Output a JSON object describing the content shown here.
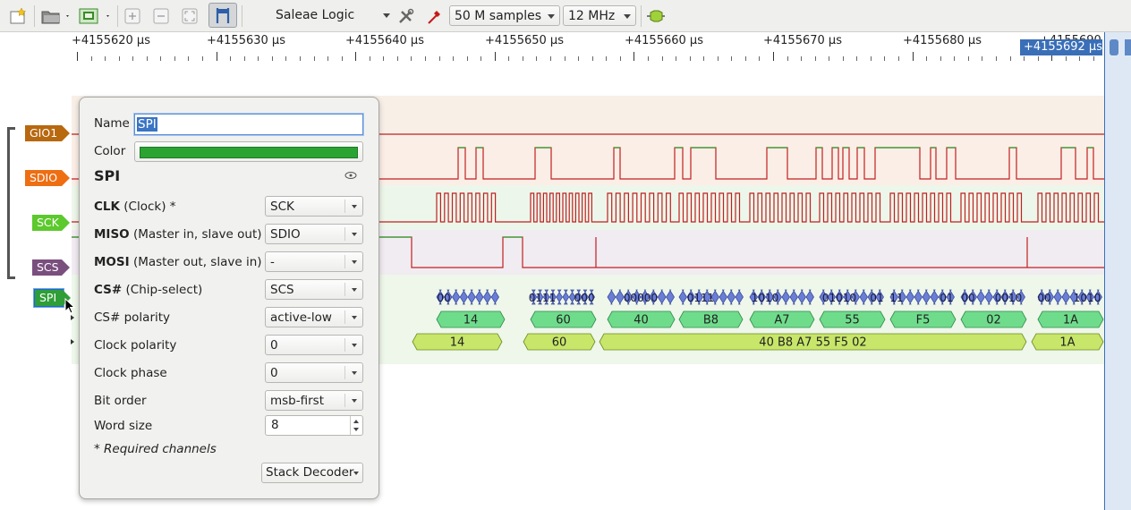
{
  "toolbar": {
    "device": "Saleae Logic",
    "samples": "50 M samples",
    "rate": "12 MHz"
  },
  "ruler": {
    "ticks": [
      "+4155620 µs",
      "+4155630 µs",
      "+4155640 µs",
      "+4155650 µs",
      "+4155660 µs",
      "+4155670 µs",
      "+4155680 µs"
    ],
    "partial_tick": "+4155690",
    "cursor": "+4155692 µs"
  },
  "channels": [
    {
      "name": "GIO1",
      "color": "#b8680f"
    },
    {
      "name": "SDIO",
      "color": "#ee6e12"
    },
    {
      "name": "SCK",
      "color": "#5cc92c"
    },
    {
      "name": "SCS",
      "color": "#7a4f7e"
    }
  ],
  "analyzer": {
    "name": "SPI",
    "color": "#2f9e38"
  },
  "decoded": {
    "bits": [
      "00",
      "0111",
      "000",
      "00000",
      "0111",
      "1010",
      "01010",
      "01",
      "11",
      "01",
      "00",
      "0010",
      "00",
      "1010"
    ],
    "bytes": [
      "14",
      "60",
      "40",
      "B8",
      "A7",
      "55",
      "F5",
      "02",
      "1A"
    ],
    "packets": [
      "14",
      "60",
      "40 B8 A7 55 F5 02",
      "1A"
    ]
  },
  "popup": {
    "name_label": "Name",
    "name_value": "SPI",
    "color_label": "Color",
    "color_value": "#2aa332",
    "title": "SPI",
    "rows": [
      {
        "bold": "CLK",
        "rest": " (Clock) *",
        "value": "SCK"
      },
      {
        "bold": "MISO",
        "rest": " (Master in, slave out)",
        "value": "SDIO"
      },
      {
        "bold": "MOSI",
        "rest": " (Master out, slave in)",
        "value": "-"
      },
      {
        "bold": "CS#",
        "rest": " (Chip-select)",
        "value": "SCS"
      },
      {
        "bold": "",
        "rest": "CS# polarity",
        "value": "active-low"
      },
      {
        "bold": "",
        "rest": "Clock polarity",
        "value": "0"
      },
      {
        "bold": "",
        "rest": "Clock phase",
        "value": "0"
      },
      {
        "bold": "",
        "rest": "Bit order",
        "value": "msb-first"
      }
    ],
    "word_size_label": "Word size",
    "word_size_value": "8",
    "required_note": "* Required channels",
    "stack_decoder": "Stack Decoder"
  }
}
